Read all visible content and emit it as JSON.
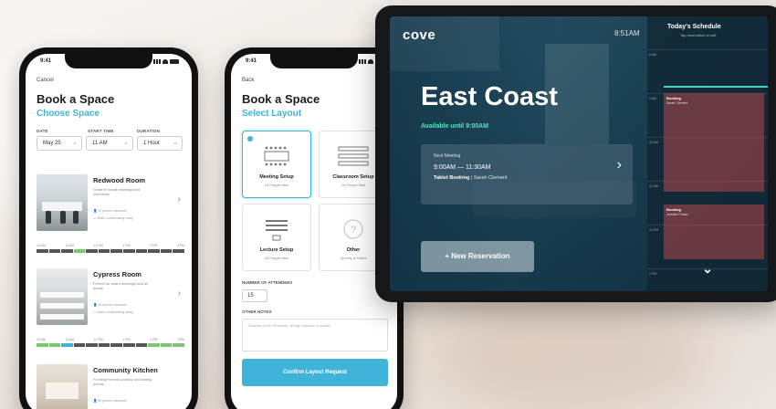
{
  "phone1": {
    "status_time": "9:41",
    "cancel": "Cancel",
    "title": "Book a Space",
    "subtitle": "Choose Space",
    "fields": [
      {
        "label": "DATE",
        "value": "May 25"
      },
      {
        "label": "START TIME",
        "value": "11 AM"
      },
      {
        "label": "DURATION",
        "value": "1 Hour"
      }
    ],
    "timeline_labels": [
      "10 AM",
      "11 AM",
      "12 PM",
      "1 PM",
      "2 PM",
      "3 PM"
    ],
    "rooms": [
      {
        "name": "Redwood Room",
        "desc": "Great for small meetings and interviews",
        "feat1": "12 person maximum",
        "feat2": "Video conferencing ready"
      },
      {
        "name": "Cypress Room",
        "desc": "Perfect for board meetings and all hands",
        "feat1": "20 person maximum",
        "feat2": "Video conferencing ready"
      },
      {
        "name": "Community Kitchen",
        "desc": "For large format cooking and tasting events",
        "feat1": "30 person maximum",
        "feat2": ""
      }
    ]
  },
  "phone2": {
    "status_time": "9:41",
    "back": "Back",
    "title": "Book a Space",
    "subtitle": "Select Layout",
    "layouts": [
      {
        "name": "Meeting Setup",
        "cap": "24 People Max"
      },
      {
        "name": "Classroom Setup",
        "cap": "24 People Max"
      },
      {
        "name": "Lecture Setup",
        "cap": "30 People Max"
      },
      {
        "name": "Other",
        "cap": "Specify in Notes"
      }
    ],
    "attendees_label": "NUMBER OF ATTENDEES",
    "attendees_value": "15",
    "notes_label": "OTHER NOTES",
    "notes_placeholder": "Screens or AV Requests, timing requests or similar",
    "confirm": "Confirm Layout Request"
  },
  "tablet": {
    "logo": "cove",
    "time": "8:51AM",
    "room": "East Coast",
    "available": "Available until 9:00AM",
    "next_label": "Next Meeting",
    "next_time": "9:00AM — 11:30AM",
    "next_title": "Tablet Booking",
    "next_person": "Sarah Clement",
    "new_reservation": "+ New Reservation",
    "schedule_title": "Today's Schedule",
    "schedule_sub": "Tap reservation to edit",
    "hours": [
      "8 AM",
      "9 AM",
      "10 AM",
      "11 AM",
      "12 PM",
      "1 PM"
    ],
    "bookings": [
      {
        "title": "Booking",
        "name": "Sarah Clement"
      },
      {
        "title": "Booking",
        "name": "Jennifer Parker"
      }
    ]
  },
  "colors": {
    "accent": "#3fb3d8",
    "available": "#5ee0c0",
    "booking": "#b4464b"
  }
}
